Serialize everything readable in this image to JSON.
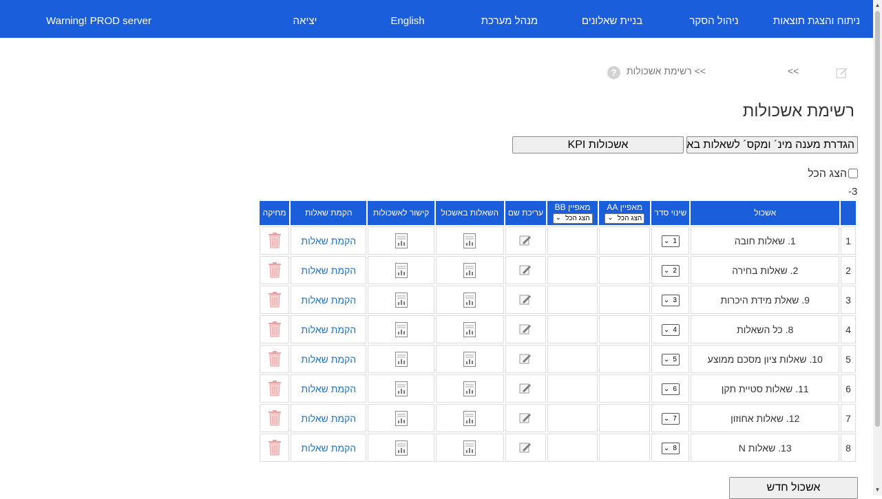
{
  "nav": {
    "warning": "Warning! PROD server",
    "logout": "יציאה",
    "english": "English",
    "admin": "מנהל מערכת",
    "build_questionnaires": "בניית שאלונים",
    "survey_mgmt": "ניהול הסקר",
    "analysis": "ניתוח והצגת תוצאות"
  },
  "breadcrumb": {
    "back": ">>",
    "current": ">> רשימת אשכולות",
    "help": "?"
  },
  "page": {
    "title": "רשימת אשכולות",
    "minmax_button": "הגדרת מענה מינ´ ומקס´ לשאלות באשכולות",
    "kpi_button": "אשכולות KPI",
    "show_all_label": "הצג הכל",
    "count_text": "-3",
    "new_cluster_button": "אשכול חדש"
  },
  "table": {
    "headers": {
      "num": "",
      "cluster": "אשכול",
      "order": "שינוי סדר",
      "aa": "מאפיין AA",
      "aa_filter": "הצג הכל",
      "bb": "מאפיין BB",
      "bb_filter": "הצג הכל",
      "edit_name": "עריכת שם",
      "questions": "השאלות באשכול",
      "link": "קישור לאשכולות",
      "setup": "הקמת שאלות",
      "delete": "מחיקה"
    },
    "rows": [
      {
        "num": "1",
        "name": "1. שאלות חובה",
        "order": "1",
        "setup": "הקמת שאלות"
      },
      {
        "num": "2",
        "name": "2. שאלות בחירה",
        "order": "2",
        "setup": "הקמת שאלות"
      },
      {
        "num": "3",
        "name": "9. שאלת מידת היכרות",
        "order": "3",
        "setup": "הקמת שאלות"
      },
      {
        "num": "4",
        "name": "8. כל השאלות",
        "order": "4",
        "setup": "הקמת שאלות"
      },
      {
        "num": "5",
        "name": "10. שאלות ציון מסכם ממוצע",
        "order": "5",
        "setup": "הקמת שאלות"
      },
      {
        "num": "6",
        "name": "11. שאלות סטיית תקן",
        "order": "6",
        "setup": "הקמת שאלות"
      },
      {
        "num": "7",
        "name": "12. שאלות אחוזון",
        "order": "7",
        "setup": "הקמת שאלות"
      },
      {
        "num": "8",
        "name": "13. שאלות N",
        "order": "8",
        "setup": "הקמת שאלות"
      }
    ]
  },
  "icons": {
    "help": "help-circle-icon",
    "edit_page": "edit-page-icon",
    "doc": "spreadsheet-doc-icon",
    "pencil": "pencil-edit-icon",
    "trash": "trash-icon",
    "chevron": "chevron-down-icon"
  },
  "colors": {
    "nav_bg": "#1a5edb",
    "header_bg": "#1a5edb",
    "link": "#1a73c8",
    "trash": "#e8a0a0"
  }
}
